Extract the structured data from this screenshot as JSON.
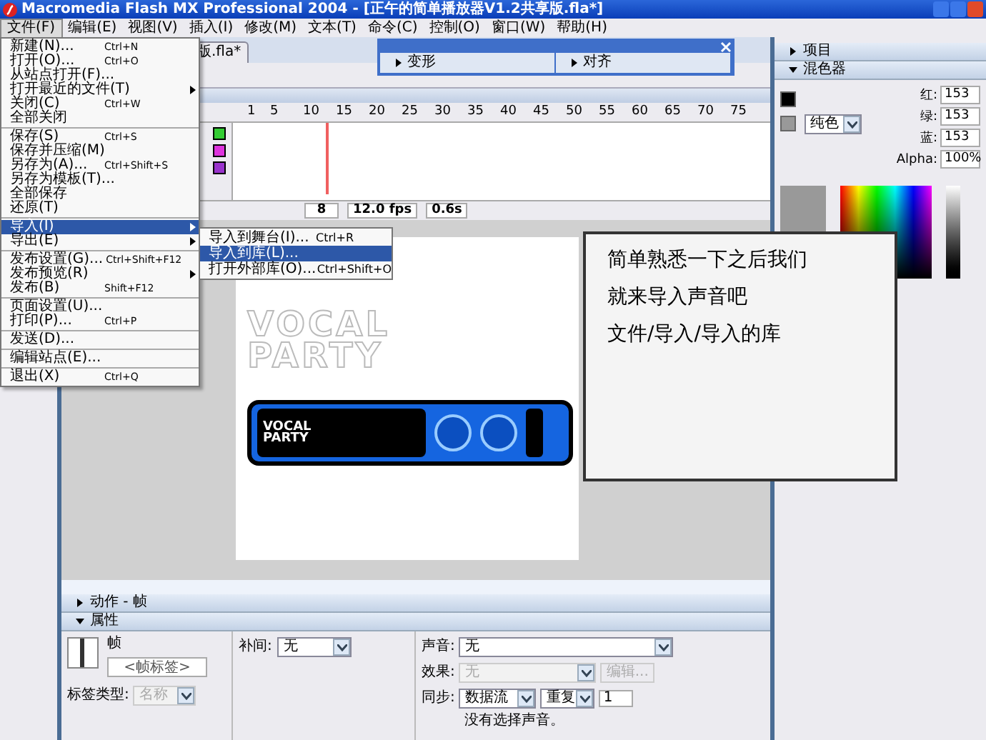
{
  "window": {
    "title": "Macromedia Flash MX Professional 2004 - [正午的简单播放器V1.2共享版.fla*]"
  },
  "menubar": [
    {
      "label": "文件(F)",
      "selected": true
    },
    {
      "label": "编辑(E)",
      "selected": false
    },
    {
      "label": "视图(V)",
      "selected": false
    },
    {
      "label": "插入(I)",
      "selected": false
    },
    {
      "label": "修改(M)",
      "selected": false
    },
    {
      "label": "文本(T)",
      "selected": false
    },
    {
      "label": "命令(C)",
      "selected": false
    },
    {
      "label": "控制(O)",
      "selected": false
    },
    {
      "label": "窗口(W)",
      "selected": false
    },
    {
      "label": "帮助(H)",
      "selected": false
    }
  ],
  "file_menu": [
    {
      "kind": "item",
      "label": "新建(N)...",
      "shortcut": "Ctrl+N",
      "submenu": false,
      "selected": false
    },
    {
      "kind": "item",
      "label": "打开(O)...",
      "shortcut": "Ctrl+O",
      "submenu": false,
      "selected": false
    },
    {
      "kind": "item",
      "label": "从站点打开(F)...",
      "submenu": false,
      "selected": false
    },
    {
      "kind": "item",
      "label": "打开最近的文件(T)",
      "submenu": true,
      "selected": false
    },
    {
      "kind": "item",
      "label": "关闭(C)",
      "shortcut": "Ctrl+W",
      "submenu": false,
      "selected": false
    },
    {
      "kind": "item",
      "label": "全部关闭",
      "submenu": false,
      "selected": false
    },
    {
      "kind": "separator"
    },
    {
      "kind": "item",
      "label": "保存(S)",
      "shortcut": "Ctrl+S",
      "submenu": false,
      "selected": false
    },
    {
      "kind": "item",
      "label": "保存并压缩(M)",
      "submenu": false,
      "selected": false
    },
    {
      "kind": "item",
      "label": "另存为(A)...",
      "shortcut": "Ctrl+Shift+S",
      "submenu": false,
      "selected": false
    },
    {
      "kind": "item",
      "label": "另存为模板(T)...",
      "submenu": false,
      "selected": false
    },
    {
      "kind": "item",
      "label": "全部保存",
      "submenu": false,
      "selected": false
    },
    {
      "kind": "item",
      "label": "还原(T)",
      "submenu": false,
      "selected": false
    },
    {
      "kind": "separator"
    },
    {
      "kind": "item",
      "label": "导入(I)",
      "submenu": true,
      "selected": true
    },
    {
      "kind": "item",
      "label": "导出(E)",
      "submenu": true,
      "selected": false
    },
    {
      "kind": "separator"
    },
    {
      "kind": "item",
      "label": "发布设置(G)...",
      "shortcut": "Ctrl+Shift+F12",
      "submenu": false,
      "selected": false
    },
    {
      "kind": "item",
      "label": "发布预览(R)",
      "submenu": true,
      "selected": false
    },
    {
      "kind": "item",
      "label": "发布(B)",
      "shortcut": "Shift+F12",
      "submenu": false,
      "selected": false
    },
    {
      "kind": "separator"
    },
    {
      "kind": "item",
      "label": "页面设置(U)...",
      "submenu": false,
      "selected": false
    },
    {
      "kind": "item",
      "label": "打印(P)...",
      "shortcut": "Ctrl+P",
      "submenu": false,
      "selected": false
    },
    {
      "kind": "separator"
    },
    {
      "kind": "item",
      "label": "发送(D)...",
      "submenu": false,
      "selected": false
    },
    {
      "kind": "separator"
    },
    {
      "kind": "item",
      "label": "编辑站点(E)...",
      "submenu": false,
      "selected": false
    },
    {
      "kind": "separator"
    },
    {
      "kind": "item",
      "label": "退出(X)",
      "shortcut": "Ctrl+Q",
      "submenu": false,
      "selected": false
    }
  ],
  "import_submenu": [
    {
      "label": "导入到舞台(I)...",
      "shortcut": "Ctrl+R",
      "selected": false
    },
    {
      "label": "导入到库(L)...",
      "selected": true
    },
    {
      "label": "打开外部库(O)...",
      "shortcut": "Ctrl+Shift+O",
      "selected": false
    }
  ],
  "document_tab": {
    "label": "版.fla*"
  },
  "floating_panel": {
    "sections": [
      {
        "label": "变形",
        "expanded": false
      },
      {
        "label": "对齐",
        "expanded": false
      }
    ]
  },
  "timeline": {
    "ruler": [
      "1",
      "5",
      "10",
      "15",
      "20",
      "25",
      "30",
      "35",
      "40",
      "45",
      "50",
      "55",
      "60",
      "65",
      "70",
      "75"
    ],
    "layers": [
      {
        "color": "#33cc33"
      },
      {
        "color": "#dd33dd"
      },
      {
        "color": "#9933cc"
      }
    ],
    "current_frame": "8",
    "frame_rate": "12.0 fps",
    "elapsed": "0.6s"
  },
  "stage": {
    "logo": [
      "VOCAL",
      "PARTY"
    ],
    "player_logo": [
      "VOCAL",
      "PARTY"
    ]
  },
  "callout": {
    "lines": [
      "简单熟悉一下之后我们",
      "就来导入声音吧",
      "文件/导入/导入的库"
    ]
  },
  "right_panel": {
    "sections": [
      {
        "label": "项目",
        "expanded": false
      },
      {
        "label": "混色器",
        "expanded": true
      }
    ],
    "mixer": {
      "fill_type": "纯色",
      "channels": [
        {
          "label": "红:",
          "value": "153"
        },
        {
          "label": "绿:",
          "value": "153"
        },
        {
          "label": "蓝:",
          "value": "153"
        },
        {
          "label": "Alpha:",
          "value": "100%"
        }
      ]
    }
  },
  "bottom_panels": [
    {
      "label": "动作 - 帧",
      "expanded": false
    },
    {
      "label": "属性",
      "expanded": true
    }
  ],
  "properties": {
    "frame_label": "帧",
    "frame_name_placeholder": "<帧标签>",
    "label_type": {
      "label": "标签类型:",
      "value": "名称",
      "disabled": true
    },
    "tween": {
      "label": "补间:",
      "value": "无"
    },
    "sound": {
      "label": "声音:",
      "value": "无"
    },
    "effect": {
      "label": "效果:",
      "value": "无",
      "disabled": true
    },
    "edit_button": {
      "label": "编辑...",
      "disabled": true
    },
    "sync": {
      "label": "同步:",
      "value": "数据流"
    },
    "repeat": {
      "value": "重复"
    },
    "repeat_count": "1",
    "status": "没有选择声音。"
  }
}
